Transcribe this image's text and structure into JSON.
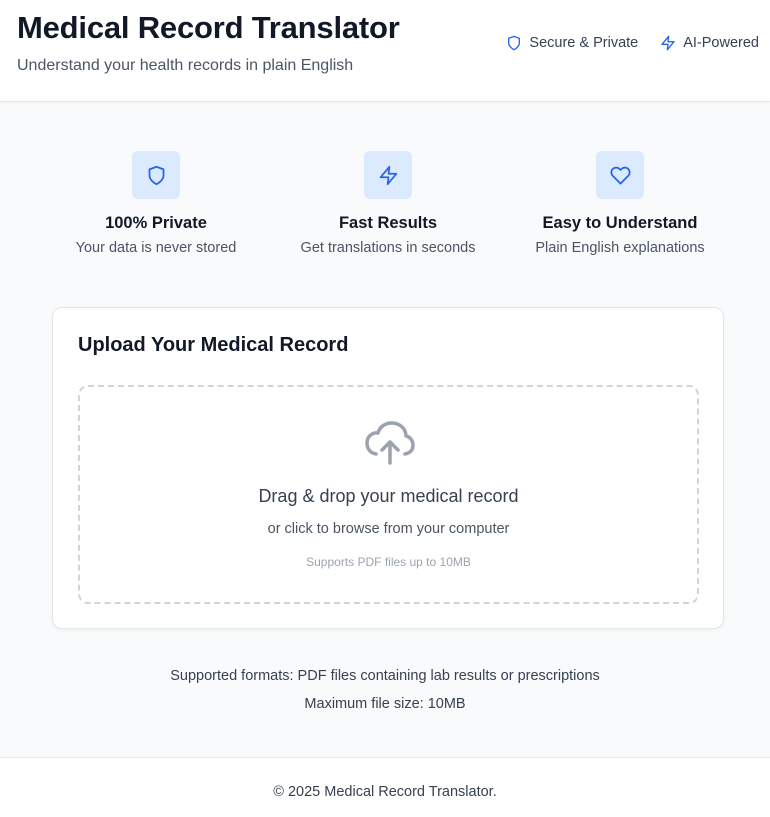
{
  "header": {
    "title": "Medical Record Translator",
    "subtitle": "Understand your health records in plain English",
    "badges": [
      {
        "icon": "shield-icon",
        "label": "Secure & Private"
      },
      {
        "icon": "lightning-icon",
        "label": "AI-Powered"
      }
    ]
  },
  "features": [
    {
      "icon": "shield-icon",
      "title": "100% Private",
      "description": "Your data is never stored"
    },
    {
      "icon": "lightning-icon",
      "title": "Fast Results",
      "description": "Get translations in seconds"
    },
    {
      "icon": "heart-icon",
      "title": "Easy to Understand",
      "description": "Plain English explanations"
    }
  ],
  "upload": {
    "title": "Upload Your Medical Record",
    "dropzone": {
      "icon": "cloud-upload-icon",
      "title": "Drag & drop your medical record",
      "subtitle": "or click to browse from your computer",
      "hint": "Supports PDF files up to 10MB"
    }
  },
  "info": {
    "formats": "Supported formats: PDF files containing lab results or prescriptions",
    "max_size": "Maximum file size: 10MB"
  },
  "footer": {
    "copyright": "© 2025 Medical Record Translator."
  },
  "colors": {
    "accent": "#2563eb",
    "icon_bg": "#dbeafe",
    "page_bg": "#f9fafb",
    "heading": "#111827",
    "muted": "#4b5563",
    "upload_icon": "#9ca3af"
  }
}
